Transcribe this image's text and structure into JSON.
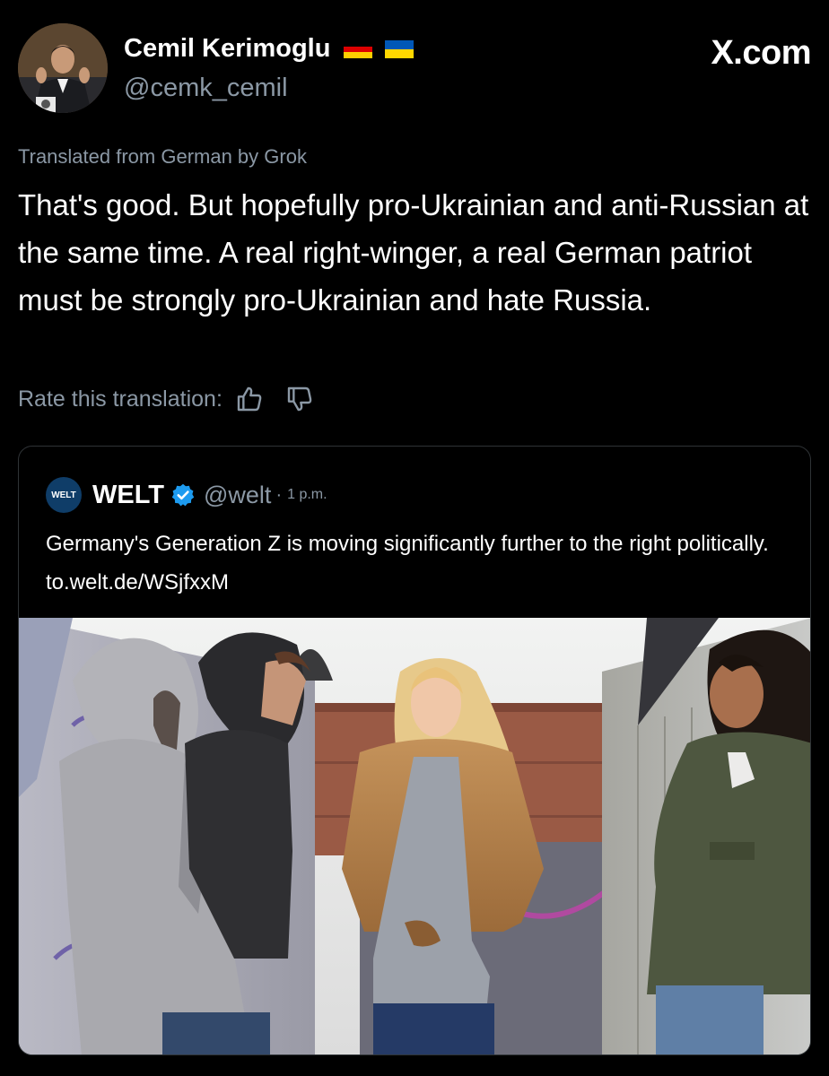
{
  "author": {
    "display_name": "Cemil Kerimoglu",
    "handle": "@cemk_cemil",
    "flags": [
      "germany-flag",
      "ukraine-flag"
    ]
  },
  "site_watermark": "X.com",
  "translation_note": "Translated from German by Grok",
  "post_text": "That's good. But hopefully pro-Ukrainian and anti-Russian at the same time. A real right-winger, a real German patriot must be strongly pro-Ukrainian and hate Russia.",
  "rate_translation": {
    "label": "Rate this translation:",
    "icons": [
      "thumbs-up-icon",
      "thumbs-down-icon"
    ]
  },
  "quoted_post": {
    "logo_text": "WELT",
    "name": "WELT",
    "handle": "@welt",
    "separator": "·",
    "time": "1 p.m.",
    "text": "Germany's Generation Z is moving significantly further to the right politically. to.welt.de/WSjfxxM",
    "image_description_icon": "photo"
  },
  "colors": {
    "background": "#000000",
    "secondary_text": "#8b98a5",
    "verified_blue": "#1d9bf0",
    "border": "#2f3336"
  }
}
